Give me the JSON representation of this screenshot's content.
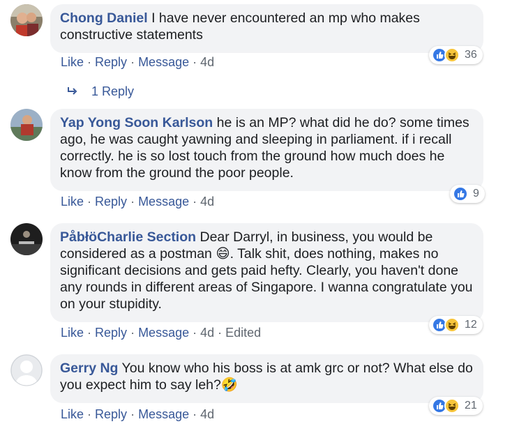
{
  "comments": [
    {
      "author": "Chong Daniel",
      "text": "I have never encountered an mp who makes constructive statements",
      "actions": [
        "Like",
        "Reply",
        "Message",
        "4d"
      ],
      "reactions": {
        "icons": [
          "like-icon",
          "haha-icon"
        ],
        "count": "36"
      },
      "replies_label": "1 Reply"
    },
    {
      "author": "Yap Yong Soon Karlson",
      "text": "he is an MP? what did he do? some times ago, he was caught yawning and sleeping in parliament. if i recall correctly. he is so lost touch from the ground how much does he know from the ground the poor people.",
      "actions": [
        "Like",
        "Reply",
        "Message",
        "4d"
      ],
      "reactions": {
        "icons": [
          "like-icon"
        ],
        "count": "9"
      }
    },
    {
      "author": "PåbłöCharlie Section",
      "text_before_emoji": "Dear Darryl, in business, you would be considered as a postman",
      "emoji": "😄",
      "text_after_emoji": ". Talk shit, does nothing, makes no significant decisions and gets paid hefty. Clearly, you haven't done any rounds in different areas of Singapore. I wanna congratulate you on your stupidity.",
      "actions": [
        "Like",
        "Reply",
        "Message",
        "4d",
        "Edited"
      ],
      "reactions": {
        "icons": [
          "like-icon",
          "haha-icon"
        ],
        "count": "12"
      }
    },
    {
      "author": "Gerry Ng",
      "text": "You know who his boss is at amk grc or not? What else do you expect him to say leh?",
      "emoji": "🤣",
      "actions": [
        "Like",
        "Reply",
        "Message",
        "4d"
      ],
      "reactions": {
        "icons": [
          "like-icon",
          "haha-icon"
        ],
        "count": "21"
      }
    }
  ],
  "colors": {
    "link": "#385898",
    "bubble": "#f2f3f5",
    "like": "#3578e5",
    "haha": "#f7c53b",
    "meta": "#606770"
  }
}
